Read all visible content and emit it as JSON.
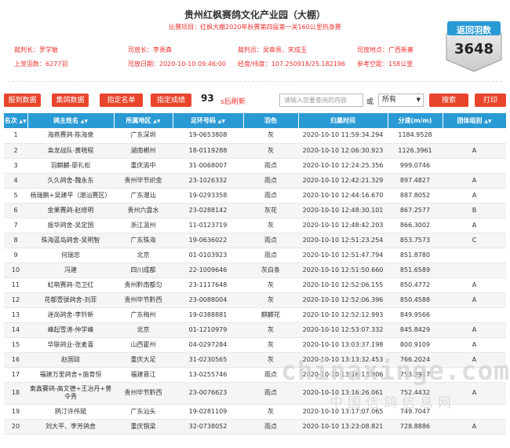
{
  "header": {
    "title": "贵州红枫赛鸽文化产业园（大棚）",
    "subtitle_label": "比赛项目：",
    "subtitle_value": "红枫大棚2020年秋赛第四届第一关160公里热身赛"
  },
  "info": {
    "referee_label": "裁判长：",
    "referee": "罗学敏",
    "releaser_label": "司放长：",
    "releaser": "李贵森",
    "judges_label": "裁判员：",
    "judges": "吴章贵、宋成玉",
    "location_label": "司放地点：",
    "location": "广西新寨",
    "count_label": "上笼羽数：",
    "count": "6277羽",
    "date_label": "司放日期：",
    "date": "2020-10-10 09:46:00",
    "coords_label": "经度/纬度：",
    "coords": "107.250918/25.182196",
    "distance_label": "参考空距：",
    "distance": "158公里"
  },
  "badge": {
    "caption": "返回羽数",
    "value": "3648"
  },
  "toolbar": {
    "report_label": "报到数据",
    "collect_label": "集鸽数据",
    "named_label": "指定名单",
    "results_label": "指定成绩",
    "countdown": "93",
    "refresh_text": "s后刷新",
    "search_placeholder": "请输入您要查询的内容",
    "or_text": "或",
    "filter_value": "所有",
    "search_label": "搜索",
    "print_label": "打印"
  },
  "table": {
    "headers": [
      "名次",
      "鸽主姓名",
      "所属地区",
      "足环号码",
      "羽色",
      "归巢时间",
      "分速(m/m)",
      "团体组别"
    ],
    "rows": [
      {
        "rank": "1",
        "owner": "海燕赛鸽-陈海泉",
        "region": "广东深圳",
        "ring": "19-0653808",
        "color": "灰",
        "time": "2020-10-10 11:59:34.294",
        "speed": "1184.9528",
        "group": ""
      },
      {
        "rank": "2",
        "owner": "枭龙战队-黄晓程",
        "region": "湖南郴州",
        "ring": "18-0119288",
        "color": "灰",
        "time": "2020-10-10 12:06:30.923",
        "speed": "1126.3961",
        "group": "A"
      },
      {
        "rank": "3",
        "owner": "羽麒麟-廖礼松",
        "region": "重庆渝中",
        "ring": "31-0068007",
        "color": "雨点",
        "time": "2020-10-10 12:24:25.356",
        "speed": "999.0746",
        "group": ""
      },
      {
        "rank": "4",
        "owner": "久久鸽舍-魏永东",
        "region": "贵州毕节织金",
        "ring": "23-1026332",
        "color": "雨点",
        "time": "2020-10-10 12:42:21.329",
        "speed": "897.4827",
        "group": "A"
      },
      {
        "rank": "5",
        "owner": "杨瑞鹏+吴建平（潮汕赛区）",
        "region": "广东潮汕",
        "ring": "19-0293358",
        "color": "雨点",
        "time": "2020-10-10 12:44:16.670",
        "speed": "887.8052",
        "group": "A"
      },
      {
        "rank": "6",
        "owner": "金果赛鸽-赵修明",
        "region": "贵州六盘水",
        "ring": "23-0288142",
        "color": "灰花",
        "time": "2020-10-10 12:48:30.101",
        "speed": "867.2577",
        "group": "B"
      },
      {
        "rank": "7",
        "owner": "振华鸽舍-吴定国",
        "region": "浙江温州",
        "ring": "11-0123719",
        "color": "灰",
        "time": "2020-10-10 12:48:42.203",
        "speed": "866.3002",
        "group": "A"
      },
      {
        "rank": "8",
        "owner": "珠海蓝岛鸽舍-吴明智",
        "region": "广东珠海",
        "ring": "19-0636022",
        "color": "雨点",
        "time": "2020-10-10 12:51:23.254",
        "speed": "853.7573",
        "group": "C"
      },
      {
        "rank": "9",
        "owner": "何瑞忠",
        "region": "北京",
        "ring": "01-0103923",
        "color": "雨点",
        "time": "2020-10-10 12:51:47.794",
        "speed": "851.8780",
        "group": ""
      },
      {
        "rank": "10",
        "owner": "冯建",
        "region": "四川成都",
        "ring": "22-1009646",
        "color": "灰白条",
        "time": "2020-10-10 12:51:50.660",
        "speed": "851.6589",
        "group": ""
      },
      {
        "rank": "11",
        "owner": "虹萌赛鸽-范卫红",
        "region": "贵州黔南都匀",
        "ring": "23-1117648",
        "color": "灰",
        "time": "2020-10-10 12:52:06.155",
        "speed": "850.4772",
        "group": "A"
      },
      {
        "rank": "12",
        "owner": "花都壹號鸽舍-刘菲",
        "region": "贵州毕节黔西",
        "ring": "23-0088004",
        "color": "灰",
        "time": "2020-10-10 12:52:06.396",
        "speed": "850.4588",
        "group": "A"
      },
      {
        "rank": "13",
        "owner": "迷尚鸽舍-李钤新",
        "region": "广东梅州",
        "ring": "19-0388881",
        "color": "麒麟花",
        "time": "2020-10-10 12:52:12.993",
        "speed": "849.9566",
        "group": ""
      },
      {
        "rank": "14",
        "owner": "峰起雪涛-仲学峰",
        "region": "北京",
        "ring": "01-1210979",
        "color": "灰",
        "time": "2020-10-10 12:53:07.332",
        "speed": "845.8429",
        "group": "A"
      },
      {
        "rank": "15",
        "owner": "华联鸽业-张麦喜",
        "region": "山西霍州",
        "ring": "04-0297284",
        "color": "灰",
        "time": "2020-10-10 13:03:37.198",
        "speed": "800.9109",
        "group": "A"
      },
      {
        "rank": "16",
        "owner": "赵国琼",
        "region": "重庆大足",
        "ring": "31-0230565",
        "color": "灰",
        "time": "2020-10-10 13:13:32.453",
        "speed": "766.2024",
        "group": "A"
      },
      {
        "rank": "17",
        "owner": "福建万里鸽舍+施育恒",
        "region": "福建晋江",
        "ring": "13-0255746",
        "color": "雨点",
        "time": "2020-10-10 13:16:13.906",
        "speed": "753.3917",
        "group": ""
      },
      {
        "rank": "18",
        "owner": "東鑫賽鸽-高文德+王冶丹+曾令秀",
        "region": "贵州毕节黔西",
        "ring": "23-0076623",
        "color": "雨点",
        "time": "2020-10-10 13:16:26.061",
        "speed": "752.4432",
        "group": "A"
      },
      {
        "rank": "19",
        "owner": "鸥汀许伟斌",
        "region": "广东汕头",
        "ring": "19-0281109",
        "color": "灰",
        "time": "2020-10-10 13:17:07.065",
        "speed": "749.7047",
        "group": ""
      },
      {
        "rank": "20",
        "owner": "刘大平、李芳鸽舍",
        "region": "重庆铜梁",
        "ring": "32-0738052",
        "color": "雨点",
        "time": "2020-10-10 13:23:08.821",
        "speed": "728.8886",
        "group": "A"
      }
    ]
  },
  "watermark": {
    "domain": "chinaxinge.com",
    "cn": "中国信鸽信息网"
  },
  "colors": {
    "accent": "#2a9ad5",
    "button": "#e8452c",
    "info_text": "#ee3333"
  }
}
